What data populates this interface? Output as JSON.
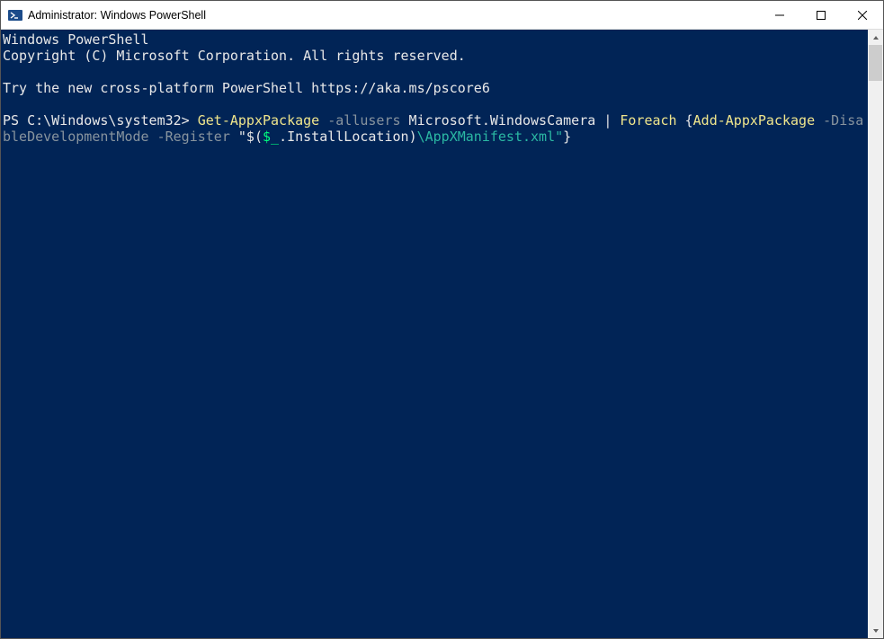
{
  "title": "Administrator: Windows PowerShell",
  "console": {
    "line1": "Windows PowerShell",
    "line2": "Copyright (C) Microsoft Corporation. All rights reserved.",
    "line3": "",
    "line4": "Try the new cross-platform PowerShell https://aka.ms/pscore6",
    "line5": "",
    "prompt": "PS C:\\Windows\\system32> ",
    "cmd": {
      "c1": "Get-AppxPackage",
      "c2": " -allusers",
      "c3": " Microsoft.WindowsCamera ",
      "c4": "|",
      "c5": " Foreach ",
      "c6": "{",
      "c7": "Add-AppxPackage",
      "c8": " -DisableDevelopmentMode -Register ",
      "c9": "\"$(",
      "c10": "$_",
      "c11": ".InstallLocation",
      "c12": ")",
      "c13": "\\AppXManifest.xml\"",
      "c14": "}"
    }
  }
}
